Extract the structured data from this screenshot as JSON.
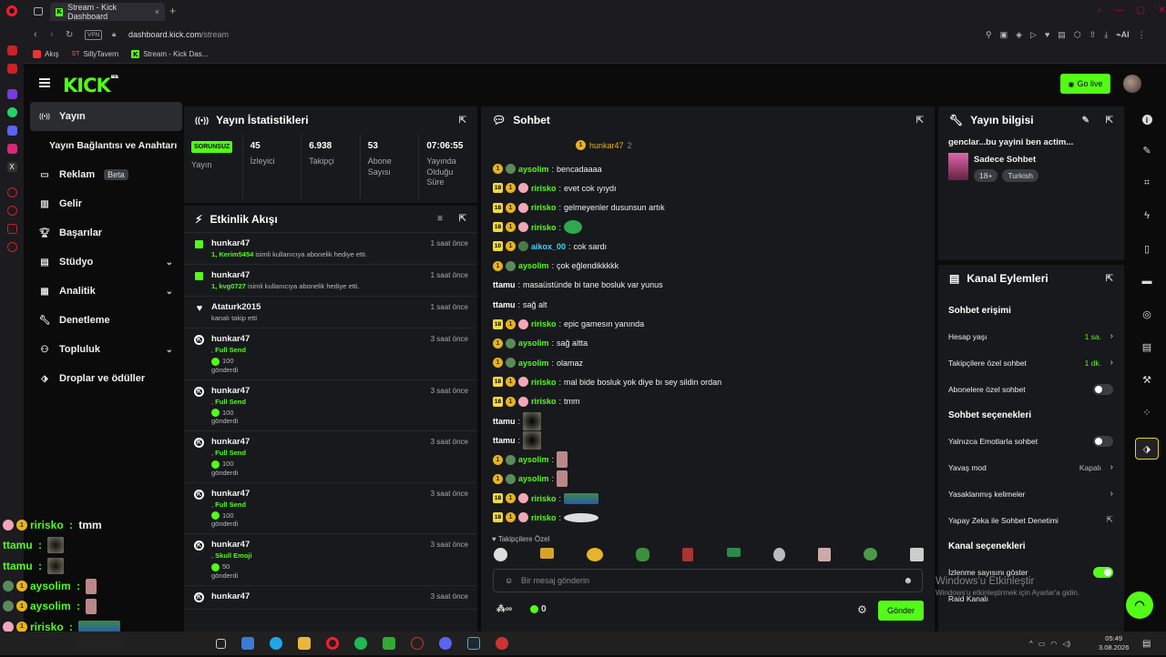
{
  "browser": {
    "tab_title": "Stream - Kick Dashboard",
    "vpn": "VPN",
    "url_domain": "dashboard.kick.com",
    "url_path": "/stream",
    "ai_label": "AI",
    "bookmarks": [
      "Akış",
      "SillyTavern",
      "Stream - Kick Das..."
    ]
  },
  "header": {
    "logo": "KICK",
    "logo_sup": "BETA",
    "go_live": "Go live"
  },
  "nav": [
    {
      "label": "Yayın",
      "icon": "broadcast-icon",
      "active": true
    },
    {
      "label": "Yayın Bağlantısı ve Anahtarı",
      "sub": true
    },
    {
      "label": "Reklam",
      "badge": "Beta",
      "icon": "ads-icon"
    },
    {
      "label": "Gelir",
      "icon": "revenue-icon"
    },
    {
      "label": "Başarılar",
      "icon": "trophy-icon"
    },
    {
      "label": "Stüdyo",
      "icon": "studio-icon",
      "chevron": true
    },
    {
      "label": "Analitik",
      "icon": "analytics-icon",
      "chevron": true
    },
    {
      "label": "Denetleme",
      "icon": "wrench-icon"
    },
    {
      "label": "Topluluk",
      "icon": "community-icon",
      "chevron": true
    },
    {
      "label": "Droplar ve ödüller",
      "icon": "gift-icon"
    }
  ],
  "stats": {
    "title": "Yayın İstatistikleri",
    "status_badge": "SORUNSUZ",
    "items": [
      {
        "value": "",
        "label": "Yayın"
      },
      {
        "value": "45",
        "label": "İzleyici"
      },
      {
        "value": "6.938",
        "label": "Takipçi"
      },
      {
        "value": "53",
        "label": "Abone Sayısı"
      },
      {
        "value": "07:06:55",
        "label": "Yayında Olduğu Süre"
      }
    ]
  },
  "activity": {
    "title": "Etkinlik Akışı",
    "items": [
      {
        "type": "gift",
        "name": "hunkar47",
        "time": "1 saat önce",
        "highlight": "1, Kerim5454",
        "desc": " isimli kullanıcıya abonelik hediye etti."
      },
      {
        "type": "gift",
        "name": "hunkar47",
        "time": "1 saat önce",
        "highlight": "1, kvg0727",
        "desc": " isimli kullanıcıya abonelik hediye etti."
      },
      {
        "type": "follow",
        "name": "Ataturk2015",
        "time": "1 saat önce",
        "desc": "kanalı takip etti"
      },
      {
        "type": "kicks",
        "name": "hunkar47",
        "time": "3 saat önce",
        "item": "Full Send",
        "amount": "100",
        "sent": "gönderdi"
      },
      {
        "type": "kicks",
        "name": "hunkar47",
        "time": "3 saat önce",
        "item": "Full Send",
        "amount": "100",
        "sent": "gönderdi"
      },
      {
        "type": "kicks",
        "name": "hunkar47",
        "time": "3 saat önce",
        "item": "Full Send",
        "amount": "100",
        "sent": "gönderdi"
      },
      {
        "type": "kicks",
        "name": "hunkar47",
        "time": "3 saat önce",
        "item": "Full Send",
        "amount": "100",
        "sent": "gönderdi"
      },
      {
        "type": "kicks",
        "name": "hunkar47",
        "time": "3 saat önce",
        "item": "Skull Emoji",
        "amount": "50",
        "sent": "gönderdi"
      },
      {
        "type": "kicks",
        "name": "hunkar47",
        "time": "3 saat önce",
        "item": "",
        "amount": "",
        "sent": ""
      }
    ]
  },
  "chat": {
    "title": "Sohbet",
    "pinned_user": "hunkar47",
    "pinned_count": "2",
    "messages": [
      {
        "badges": [
          "sub",
          "av"
        ],
        "user": "aysolim",
        "color": "#53fc18",
        "text": "bencadaaaa"
      },
      {
        "badges": [
          "18",
          "sub",
          "pig"
        ],
        "user": "ririsko",
        "color": "#53fc18",
        "text": "evet cok ıyıydı"
      },
      {
        "badges": [
          "18",
          "sub",
          "pig"
        ],
        "user": "ririsko",
        "color": "#53fc18",
        "text": "gelmeyenler dusunsun artık"
      },
      {
        "badges": [
          "18",
          "sub",
          "pig"
        ],
        "user": "ririsko",
        "color": "#53fc18",
        "text": "",
        "emote": "green"
      },
      {
        "badges": [
          "10",
          "sub",
          "av2"
        ],
        "user": "aikox_00",
        "color": "#3fd3f5",
        "text": "cok sardı"
      },
      {
        "badges": [
          "sub",
          "av"
        ],
        "user": "aysolim",
        "color": "#53fc18",
        "text": "çok eğlendikkkkk"
      },
      {
        "badges": [],
        "user": "ttamu",
        "color": "#ffffff",
        "text": "masaüstünde bi tane bosluk var yunus"
      },
      {
        "badges": [],
        "user": "ttamu",
        "color": "#ffffff",
        "text": "sağ alt"
      },
      {
        "badges": [
          "18",
          "sub",
          "pig"
        ],
        "user": "ririsko",
        "color": "#53fc18",
        "text": "epic gamesın yanında"
      },
      {
        "badges": [
          "sub",
          "av"
        ],
        "user": "aysolim",
        "color": "#53fc18",
        "text": "sağ altta"
      },
      {
        "badges": [
          "sub",
          "av"
        ],
        "user": "aysolim",
        "color": "#53fc18",
        "text": "olamaz"
      },
      {
        "badges": [
          "18",
          "sub",
          "pig"
        ],
        "user": "ririsko",
        "color": "#53fc18",
        "text": "mal bide bosluk yok diye bı sey sildin ordan"
      },
      {
        "badges": [
          "18",
          "sub",
          "pig"
        ],
        "user": "ririsko",
        "color": "#53fc18",
        "text": "tmm"
      },
      {
        "badges": [],
        "user": "ttamu",
        "color": "#ffffff",
        "text": "",
        "emote": "dark"
      },
      {
        "badges": [],
        "user": "ttamu",
        "color": "#ffffff",
        "text": "",
        "emote": "dark"
      },
      {
        "badges": [
          "sub",
          "av"
        ],
        "user": "aysolim",
        "color": "#53fc18",
        "text": "",
        "emote": "pink"
      },
      {
        "badges": [
          "sub",
          "av"
        ],
        "user": "aysolim",
        "color": "#53fc18",
        "text": "",
        "emote": "pink"
      },
      {
        "badges": [
          "18",
          "sub",
          "pig"
        ],
        "user": "ririsko",
        "color": "#53fc18",
        "text": "",
        "emote": "wide"
      },
      {
        "badges": [
          "18",
          "sub",
          "pig"
        ],
        "user": "ririsko",
        "color": "#53fc18",
        "text": "",
        "emote": "widewhite"
      }
    ],
    "followers_only": "Takipçilere Özel",
    "input_placeholder": "Bir mesaj gönderin",
    "infinity": "∞",
    "kicks_count": "0",
    "send": "Gönder"
  },
  "info": {
    "title": "Yayın bilgisi",
    "stream_title": "genclar...bu yayini ben actim...",
    "category": "Sadece Sohbet",
    "tags": [
      "18+",
      "Turkish"
    ]
  },
  "actions": {
    "title": "Kanal Eylemleri",
    "sections": [
      {
        "title": "Sohbet erişimi",
        "rows": [
          {
            "label": "Hesap yaşı",
            "value": "1 sa.",
            "kind": "chevron"
          },
          {
            "label": "Takipçilere özel sohbet",
            "value": "1 dk.",
            "kind": "chevron"
          },
          {
            "label": "Abonelere özel sohbet",
            "kind": "toggle-off"
          }
        ]
      },
      {
        "title": "Sohbet seçenekleri",
        "rows": [
          {
            "label": "Yalnızca Emotlarla sohbet",
            "kind": "toggle-off"
          },
          {
            "label": "Yavaş mod",
            "value": "Kapalı",
            "kind": "chevron-grey"
          },
          {
            "label": "Yasaklanmış kelimeler",
            "kind": "chevron"
          },
          {
            "label": "Yapay Zeka ile Sohbet Denetimi",
            "kind": "external"
          }
        ]
      },
      {
        "title": "Kanal seçenekleri",
        "rows": [
          {
            "label": "İzlenme sayısını göster",
            "kind": "toggle-on"
          },
          {
            "label": "Raid Kanalı",
            "kind": "none"
          }
        ]
      }
    ]
  },
  "watermark": {
    "line1": "Windows'u Etkinleştir",
    "line2": "Windows'u etkinleştirmek için Ayarlar'a gidin."
  },
  "overlay": [
    {
      "user": "ririsko",
      "sep": " : ",
      "text": "tmm",
      "color": "#53fc18"
    },
    {
      "user": "ttamu",
      "sep": " : ",
      "text": "",
      "color": "#53fc18"
    },
    {
      "user": "ttamu",
      "sep": " : ",
      "text": "",
      "color": "#53fc18"
    },
    {
      "user": "aysolim",
      "sep": " : ",
      "text": "",
      "color": "#53fc18"
    },
    {
      "user": "aysolim",
      "sep": " : ",
      "text": "",
      "color": "#53fc18"
    },
    {
      "user": "ririsko",
      "sep": " : ",
      "text": "",
      "color": "#53fc18"
    },
    {
      "user": "ririsko",
      "sep": "",
      "text": "",
      "color": "#53fc18"
    }
  ],
  "taskbar": {
    "time": "05:49",
    "date": "3.08.2026"
  },
  "colors": {
    "accent": "#53fc18",
    "panel": "#18191c",
    "bg": "#0b0b0c",
    "gold": "#e6b422"
  }
}
